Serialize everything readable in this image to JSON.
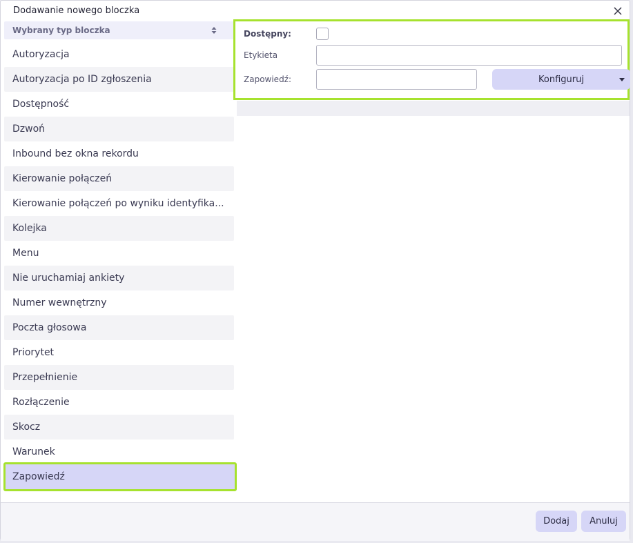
{
  "dialog": {
    "title": "Dodawanie nowego bloczka"
  },
  "list": {
    "header": "Wybrany typ bloczka",
    "items": [
      "Autoryzacja",
      "Autoryzacja po ID zgłoszenia",
      "Dostępność",
      "Dzwoń",
      "Inbound bez okna rekordu",
      "Kierowanie połączeń",
      "Kierowanie połączeń po wyniku identyfika...",
      "Kolejka",
      "Menu",
      "Nie uruchamiaj ankiety",
      "Numer wewnętrzny",
      "Poczta głosowa",
      "Priorytet",
      "Przepełnienie",
      "Rozłączenie",
      "Skocz",
      "Warunek",
      "Zapowiedź"
    ],
    "selected": "Zapowiedź"
  },
  "form": {
    "available_label": "Dostępny:",
    "available_checked": false,
    "label_label": "Etykieta",
    "label_value": "",
    "announcement_label": "Zapowiedź:",
    "announcement_value": "",
    "configure_button": "Konfiguruj"
  },
  "footer": {
    "add_button": "Dodaj",
    "cancel_button": "Anuluj"
  },
  "colors": {
    "accent": "#d6d6f7",
    "highlight": "#a6e22e",
    "header_bg": "#efeffa"
  },
  "icons": {
    "close": "close-icon",
    "sort": "sort-icon",
    "dropdown": "chevron-down-icon"
  }
}
